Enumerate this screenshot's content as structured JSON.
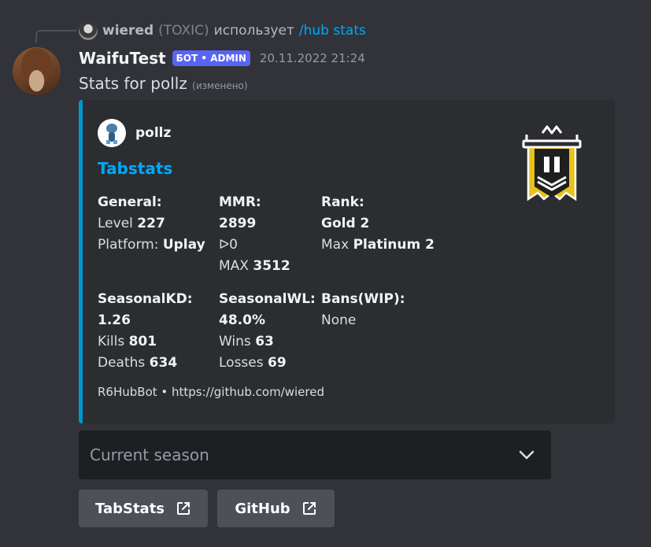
{
  "reply": {
    "user": "wiered",
    "tag": "(TOXIC)",
    "text": "использует",
    "command": "/hub stats"
  },
  "message": {
    "username": "WaifuTest",
    "badge": "БОТ • ADMIN",
    "timestamp": "20.11.2022 21:24",
    "text": "Stats for pollz",
    "edited": "(изменено)"
  },
  "embed": {
    "accent_color": "#0096cf",
    "author": "pollz",
    "title": "Tabstats",
    "footer": "R6HubBot • https://github.com/wiered",
    "fields": {
      "general": {
        "name": "General:",
        "level_label": "Level",
        "level_value": "227",
        "platform_label": "Platform:",
        "platform_value": "Uplay"
      },
      "mmr": {
        "name": "MMR:",
        "value": "2899",
        "change": "ᐅ0",
        "max_label": "MAX",
        "max_value": "3512"
      },
      "rank": {
        "name": "Rank:",
        "value": "Gold 2",
        "max_label": "Max",
        "max_value": "Platinum 2"
      },
      "kd": {
        "name": "SeasonalKD:",
        "value": "1.26",
        "kills_label": "Kills",
        "kills_value": "801",
        "deaths_label": "Deaths",
        "deaths_value": "634"
      },
      "wl": {
        "name": "SeasonalWL:",
        "value": "48.0%",
        "wins_label": "Wins",
        "wins_value": "63",
        "losses_label": "Losses",
        "losses_value": "69"
      },
      "bans": {
        "name": "Bans(WIP):",
        "value": "None"
      }
    },
    "thumbnail_icon": "gold-rank-badge-icon"
  },
  "select": {
    "placeholder": "Current season"
  },
  "buttons": {
    "tabstats": "TabStats",
    "github": "GitHub"
  }
}
